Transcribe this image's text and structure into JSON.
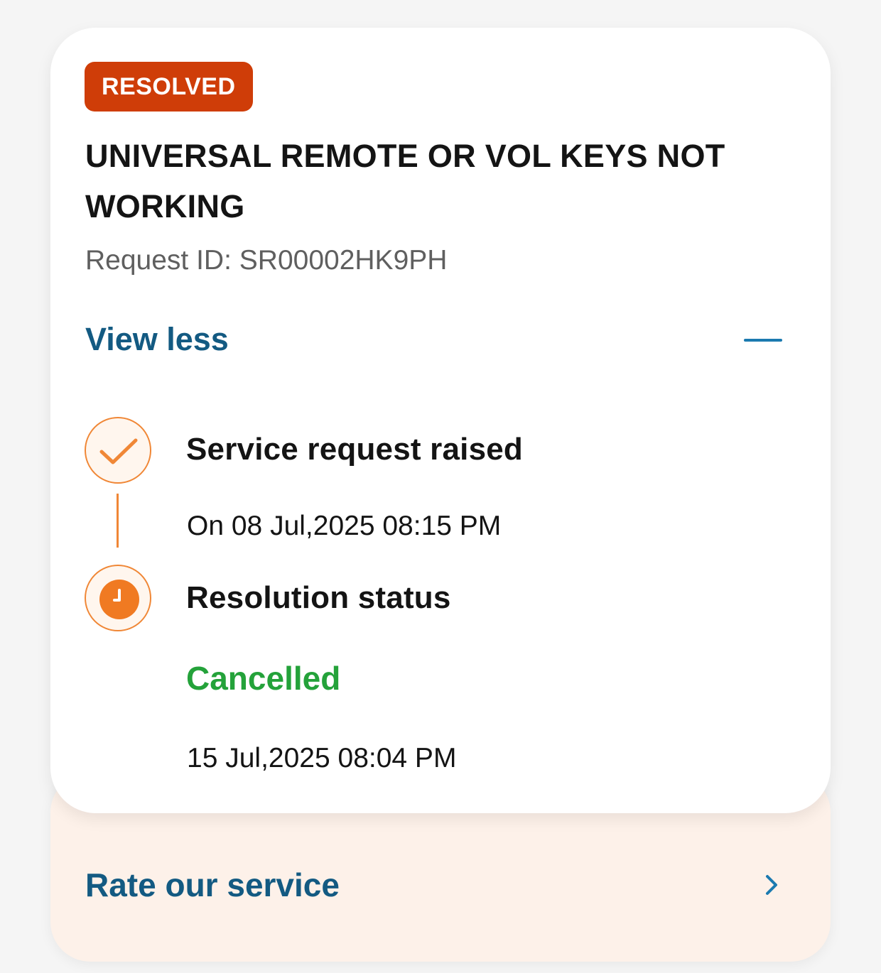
{
  "service_request": {
    "status_badge": "RESOLVED",
    "title": "UNIVERSAL REMOTE OR VOL KEYS NOT WORKING",
    "request_id": "Request ID: SR00002HK9PH",
    "view_toggle_label": "View less"
  },
  "timeline": {
    "steps": [
      {
        "title": "Service request raised",
        "detail": "On 08 Jul,2025 08:15 PM",
        "icon": "check-icon",
        "state": "completed"
      },
      {
        "title": "Resolution status",
        "status": "Cancelled",
        "detail": "15 Jul,2025 08:04 PM",
        "icon": "clock-icon",
        "state": "current"
      }
    ]
  },
  "rating": {
    "label": "Rate our service",
    "icon": "chevron-right-icon"
  },
  "colors": {
    "badge": "#cf3d08",
    "accent_orange": "#f08736",
    "link_blue": "#135a82",
    "status_green": "#24a23a",
    "rate_card_bg": "#fdf1e9"
  }
}
